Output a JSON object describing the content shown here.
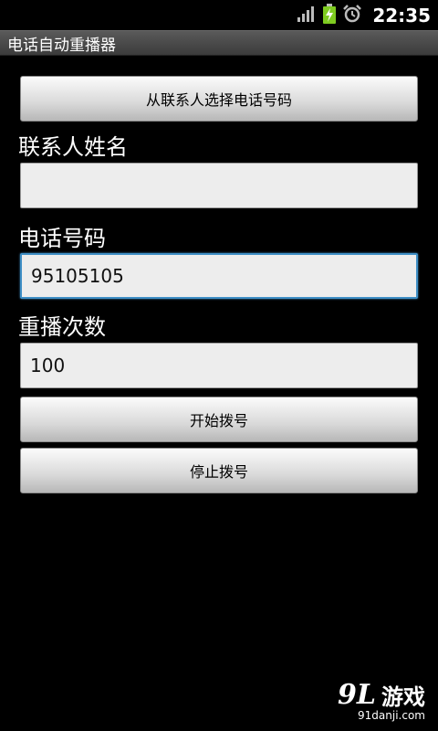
{
  "status_bar": {
    "time": "22:35",
    "icons": [
      "signal-icon",
      "battery-charging-icon",
      "alarm-icon"
    ]
  },
  "app": {
    "title": "电话自动重播器"
  },
  "form": {
    "pick_contact_button": "从联系人选择电话号码",
    "contact_name_label": "联系人姓名",
    "contact_name_value": "",
    "phone_number_label": "电话号码",
    "phone_number_value": "95105105",
    "redial_count_label": "重播次数",
    "redial_count_value": "100",
    "start_button": "开始拨号",
    "stop_button": "停止拨号"
  },
  "watermark": {
    "logo": "9L",
    "brand": "游戏",
    "domain": "91danji.com"
  },
  "colors": {
    "background": "#000000",
    "focus_border": "#3f8fc6"
  }
}
